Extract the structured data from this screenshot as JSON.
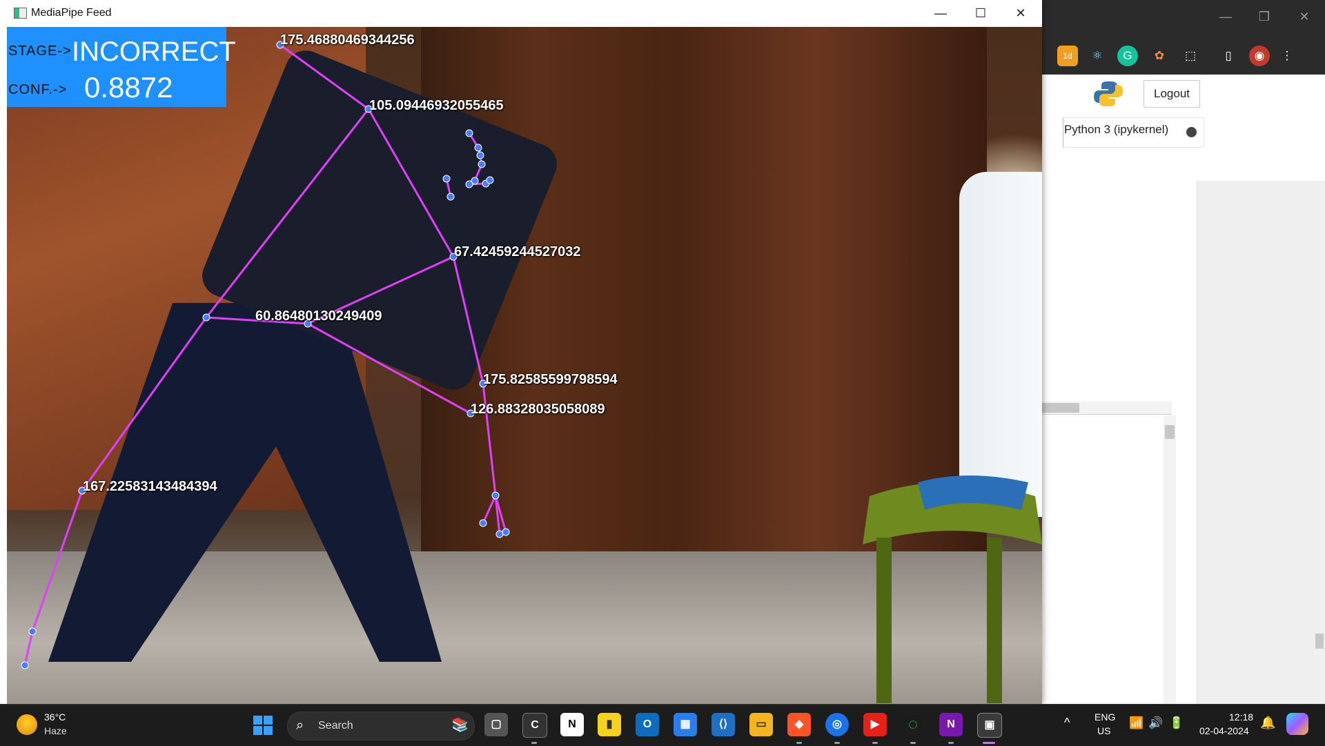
{
  "browser": {
    "window_controls": [
      "—",
      "❐",
      "✕"
    ],
    "extensions": [
      "1d",
      "⚛",
      "G",
      "✿",
      "⬚",
      "▯",
      "◉",
      "⋮"
    ],
    "logout_label": "Logout",
    "kernel_label": "Python 3 (ipykernel)"
  },
  "mediapipe": {
    "title": "MediaPipe Feed",
    "controls": {
      "minimize": "—",
      "maximize": "☐",
      "close": "✕"
    },
    "stage_key": "STAGE->",
    "stage_value": "INCORRECT",
    "conf_key": "CONF.->",
    "conf_value": "0.8872",
    "angles": [
      "175.46880469344256",
      "105.09446932055465",
      "67.42459244527032",
      "60.86480130249409",
      "175.82585599798594",
      "126.88328035058089",
      "167.22583143484394"
    ]
  },
  "taskbar": {
    "weather_temp": "36°C",
    "weather_condition": "Haze",
    "search_label": "Search",
    "apps": [
      "📚",
      "▢",
      "C",
      "N",
      "▮",
      "O",
      "▦",
      "⟨⟩",
      "▭",
      "◆",
      "◎",
      "▶",
      "◌",
      "N",
      "▣"
    ],
    "tray_chevron": "^",
    "language_line1": "ENG",
    "language_line2": "US",
    "clock_time": "12:18",
    "clock_date": "02-04-2024"
  },
  "colors": {
    "status_box": "#1e90ff",
    "skeleton_line": "#e040fb",
    "joint": "#4a7cff",
    "taskbar": "#1c1c1c"
  }
}
